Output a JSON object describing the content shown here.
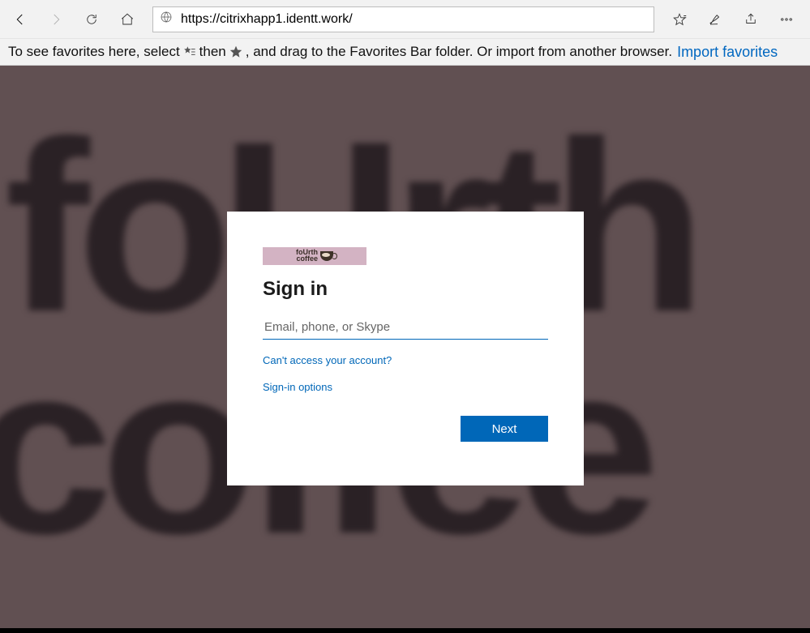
{
  "browser": {
    "url": "https://citrixhapp1.identt.work/"
  },
  "favbar": {
    "text_1": "To see favorites here, select ",
    "text_2": " then ",
    "text_3": ", and drag to the Favorites Bar folder. Or import from another browser.",
    "import_link": "Import favorites"
  },
  "background": {
    "top_text": "foUrth",
    "bottom_text": "coffee"
  },
  "signin": {
    "logo_text_1": "foUrth",
    "logo_text_2": "coffee",
    "heading": "Sign in",
    "email_placeholder": "Email, phone, or Skype",
    "cant_access": "Can't access your account?",
    "options": "Sign-in options",
    "next": "Next"
  }
}
